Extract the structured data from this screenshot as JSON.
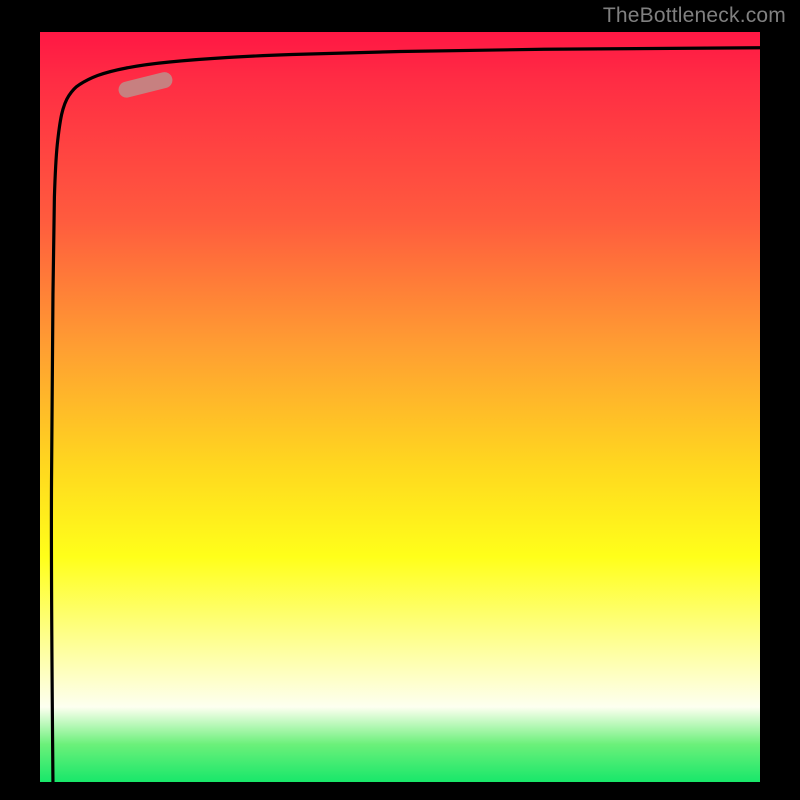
{
  "watermark": "TheBottleneck.com",
  "colors": {
    "background": "#000000",
    "gradient_top": "#ff1744",
    "gradient_mid1": "#ff9e32",
    "gradient_mid2": "#ffff1a",
    "gradient_bottom": "#18e76a",
    "curve": "#000000",
    "marker": "#c78080"
  },
  "chart_data": {
    "type": "line",
    "title": "",
    "xlabel": "",
    "ylabel": "",
    "xlim": [
      0,
      100
    ],
    "ylim": [
      0,
      100
    ],
    "series": [
      {
        "name": "bottleneck-curve",
        "x": [
          1.8,
          1.6,
          1.8,
          2.0,
          2.4,
          3.0,
          4.0,
          5.5,
          8.0,
          12,
          18,
          26,
          35,
          50,
          70,
          100
        ],
        "values": [
          0,
          40,
          65,
          78,
          85,
          89,
          91.5,
          93,
          94.2,
          95.2,
          96,
          96.6,
          97,
          97.4,
          97.7,
          97.9
        ]
      }
    ],
    "marker": {
      "x_range": [
        12,
        18
      ],
      "y_range": [
        90,
        92.5
      ],
      "note": "highlighted segment on curve (salmon pill)"
    },
    "annotations": []
  }
}
